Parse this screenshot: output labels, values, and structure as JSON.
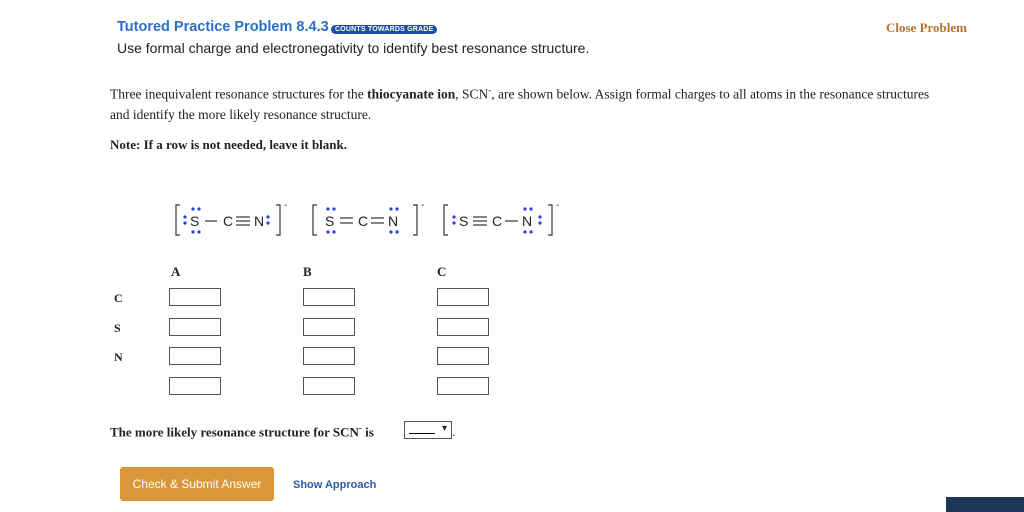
{
  "header": {
    "title": "Tutored Practice Problem 8.4.3",
    "badge": "COUNTS TOWARDS GRADE",
    "subtitle": "Use formal charge and electronegativity to identify best resonance structure.",
    "close_label": "Close Problem"
  },
  "problem": {
    "text_1": "Three inequivalent resonance structures for the ",
    "ion_name": "thiocyanate ion",
    "text_2": ", SCN",
    "charge": "-",
    "text_3": ", are shown below. Assign formal charges to all atoms in the resonance structures and identify the more likely resonance structure.",
    "note": "Note: If a row is not needed, leave it blank."
  },
  "structures": [
    {
      "label": "A",
      "atoms": [
        "S",
        "C",
        "N"
      ],
      "bonds": [
        "-",
        "≡"
      ],
      "charge": "-"
    },
    {
      "label": "B",
      "atoms": [
        "S",
        "C",
        "N"
      ],
      "bonds": [
        "=",
        "="
      ],
      "charge": "-"
    },
    {
      "label": "C",
      "atoms": [
        "S",
        "C",
        "N"
      ],
      "bonds": [
        "≡",
        "-"
      ],
      "charge": "-"
    }
  ],
  "table": {
    "columns": [
      "A",
      "B",
      "C"
    ],
    "rows": [
      "C",
      "S",
      "N",
      ""
    ]
  },
  "question": {
    "text": "The more likely resonance structure for SCN",
    "charge": "-",
    "text_end": " is",
    "selected": "",
    "period": "."
  },
  "buttons": {
    "submit": "Check & Submit Answer",
    "approach": "Show Approach"
  },
  "colors": {
    "title": "#2a6fc9",
    "close": "#b0742c",
    "submit_bg": "#d9963a",
    "lone_pair": "#2b3fd6"
  }
}
